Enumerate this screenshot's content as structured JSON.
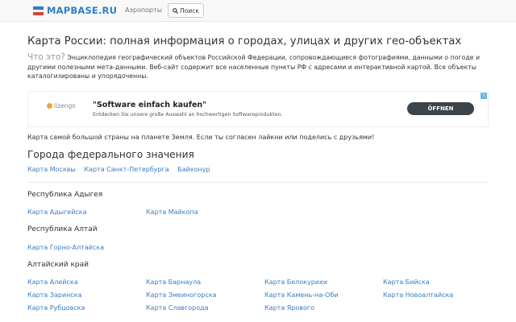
{
  "navbar": {
    "brand": "MAPBASE.RU",
    "airports": "Аэропорты",
    "search": "Поиск"
  },
  "page": {
    "title": "Карта России: полная информация о городах, улицах и других гео-объектах",
    "intro_question": "Что это?",
    "intro_text": " Энциклопедия географический объектов Российской Федерации, сопровождающиеся фотографиями, данными о погоде и другими полезными мета-данными. Веб-сайт содержит все населенные пункты РФ с адресами и интерактивной картой. Все объекты каталогизированы и упорядоченны.",
    "biggest": "Карта самой большой страны на планете Земля. Если ты согласен лайкни или поделись с друзьями!"
  },
  "ad": {
    "brand": "lizengo",
    "title": "\"Software einfach kaufen\"",
    "subtitle": "Entdecken Sie unsere große Auswahl an hochwertigen Softwareprodukten.",
    "button": "ÖFFNEN",
    "info": "i"
  },
  "federal": {
    "title": "Города федерального значения",
    "links": [
      "Карта Москвы",
      "Карта Санкт-Петербурга",
      "Байконур"
    ]
  },
  "regions": [
    {
      "name": "Республика Адыгея",
      "cities": [
        "Карта Адыгейска",
        "Карта Майкопа"
      ]
    },
    {
      "name": "Республика Алтай",
      "cities": [
        "Карта Горно-Алтайска"
      ]
    },
    {
      "name": "Алтайский край",
      "cities": [
        "Карта Алейска",
        "Карта Барнаула",
        "Карта Белокурихи",
        "Карта Бийска",
        "Карта Заринска",
        "Карта Змеиногорска",
        "Карта Камень-на-Оби",
        "Карта Новоалтайска",
        "Карта Рубцовска",
        "Карта Славгорода",
        "Карта Ярового"
      ]
    }
  ],
  "colors": {
    "link": "#3a7cc0",
    "brand": "#2f7fc7",
    "ad_button": "#3d434a"
  }
}
